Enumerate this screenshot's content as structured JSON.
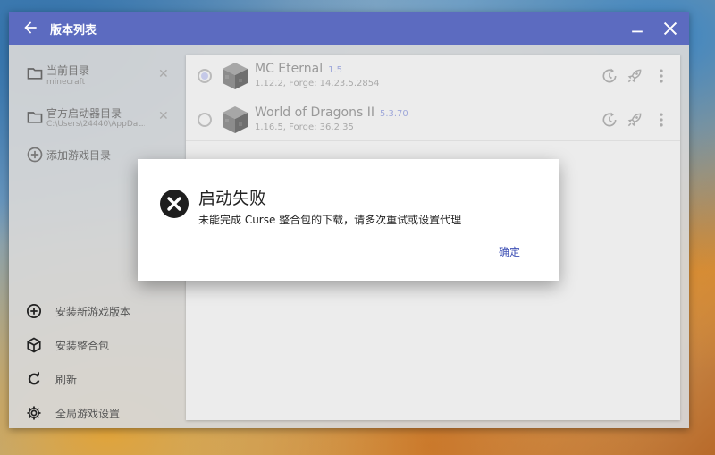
{
  "window": {
    "title": "版本列表"
  },
  "sidebar": {
    "directories": [
      {
        "label": "当前目录",
        "path": "minecraft"
      },
      {
        "label": "官方启动器目录",
        "path": "C:\\Users\\24440\\AppDat..."
      }
    ],
    "add_directory_label": "添加游戏目录",
    "actions": [
      {
        "label": "安装新游戏版本",
        "icon": "plus-circle-icon"
      },
      {
        "label": "安装整合包",
        "icon": "package-icon"
      },
      {
        "label": "刷新",
        "icon": "refresh-icon"
      },
      {
        "label": "全局游戏设置",
        "icon": "gear-icon"
      }
    ]
  },
  "versions": [
    {
      "name": "MC Eternal",
      "version": "1.5",
      "detail": "1.12.2, Forge: 14.23.5.2854",
      "selected": true
    },
    {
      "name": "World of Dragons II",
      "version": "5.3.70",
      "detail": "1.16.5, Forge: 36.2.35",
      "selected": false
    }
  ],
  "dialog": {
    "title": "启动失败",
    "message": "未能完成 Curse 整合包的下载，请多次重试或设置代理",
    "ok_label": "确定"
  },
  "colors": {
    "titlebar": "#5c6bc0",
    "accent": "#3f51b5"
  }
}
